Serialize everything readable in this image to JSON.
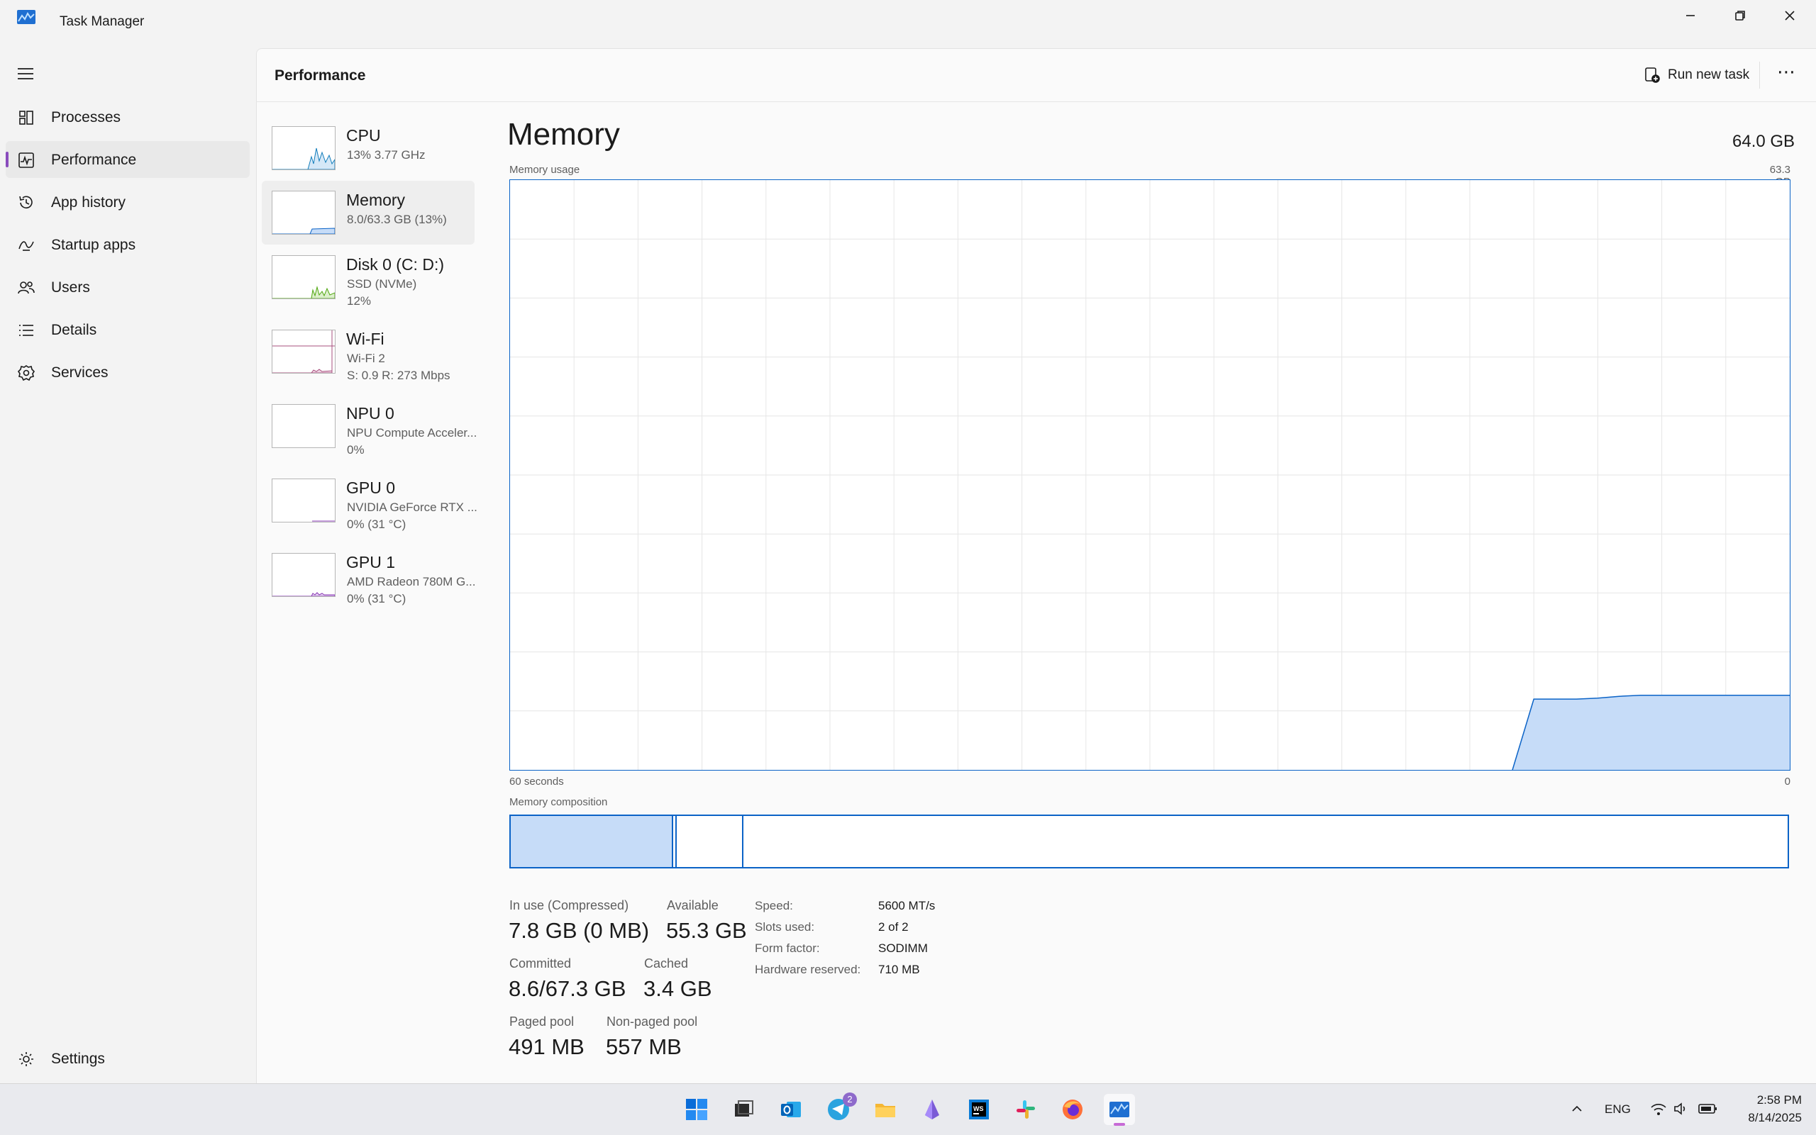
{
  "window": {
    "title": "Task Manager",
    "app_icon": "task-manager-icon"
  },
  "nav": {
    "items": [
      {
        "label": "Processes",
        "icon": "processes-icon"
      },
      {
        "label": "Performance",
        "icon": "performance-icon",
        "active": true
      },
      {
        "label": "App history",
        "icon": "app-history-icon"
      },
      {
        "label": "Startup apps",
        "icon": "startup-apps-icon"
      },
      {
        "label": "Users",
        "icon": "users-icon"
      },
      {
        "label": "Details",
        "icon": "details-icon"
      },
      {
        "label": "Services",
        "icon": "services-icon"
      }
    ],
    "settings": {
      "label": "Settings",
      "icon": "settings-icon"
    }
  },
  "header": {
    "title": "Performance",
    "run_new_task": "Run new task",
    "more": "⋯"
  },
  "resources": [
    {
      "name": "CPU",
      "sub1": "13% 3.77 GHz",
      "color": "#117dbb"
    },
    {
      "name": "Memory",
      "sub1": "8.0/63.3 GB (13%)",
      "color": "#0b63c7",
      "selected": true
    },
    {
      "name": "Disk 0 (C: D:)",
      "sub1": "SSD (NVMe)",
      "sub2": "12%",
      "color": "#4da60c"
    },
    {
      "name": "Wi-Fi",
      "sub1": "Wi-Fi 2",
      "sub2": "S: 0.9  R: 273 Mbps",
      "color": "#a74f7e"
    },
    {
      "name": "NPU 0",
      "sub1": "NPU Compute Acceler...",
      "sub2": "0%",
      "color": "#117dbb"
    },
    {
      "name": "GPU 0",
      "sub1": "NVIDIA GeForce RTX ...",
      "sub2": "0%  (31 °C)",
      "color": "#8a3ab5"
    },
    {
      "name": "GPU 1",
      "sub1": "AMD Radeon 780M G...",
      "sub2": "0%  (31 °C)",
      "color": "#8a3ab5"
    }
  ],
  "memory": {
    "title": "Memory",
    "total": "64.0 GB",
    "usage_label": "Memory usage",
    "usage_max": "63.3 GB",
    "time_left": "60 seconds",
    "time_right": "0",
    "composition_label": "Memory composition",
    "composition": {
      "in_use_fraction": 0.126,
      "modified_fraction": 0.002,
      "standby_fraction": 0.051
    },
    "usage_series_gb": [
      0,
      0,
      0,
      0,
      0,
      0,
      0,
      0,
      0,
      0,
      0,
      0,
      0,
      0,
      0,
      0,
      0,
      0,
      0,
      0,
      0,
      0,
      0,
      0,
      0,
      0,
      0,
      0,
      0,
      0,
      0,
      0,
      0,
      0,
      0,
      0,
      0,
      0,
      0,
      0,
      0,
      0,
      0,
      0,
      0,
      0,
      0,
      0,
      7.6,
      7.6,
      7.6,
      7.7,
      7.9,
      8.0,
      8.0,
      8.0,
      8.0,
      8.0,
      8.0,
      8.0,
      8.0
    ]
  },
  "stats": {
    "in_use_label": "In use (Compressed)",
    "in_use_value": "7.8 GB (0 MB)",
    "available_label": "Available",
    "available_value": "55.3 GB",
    "committed_label": "Committed",
    "committed_value": "8.6/67.3 GB",
    "cached_label": "Cached",
    "cached_value": "3.4 GB",
    "paged_label": "Paged pool",
    "paged_value": "491 MB",
    "nonpaged_label": "Non-paged pool",
    "nonpaged_value": "557 MB"
  },
  "specs": {
    "speed_label": "Speed:",
    "speed_value": "5600 MT/s",
    "slots_label": "Slots used:",
    "slots_value": "2 of 2",
    "form_label": "Form factor:",
    "form_value": "SODIMM",
    "hw_label": "Hardware reserved:",
    "hw_value": "710 MB"
  },
  "taskbar": {
    "apps": [
      "start-icon",
      "task-view-icon",
      "outlook-icon",
      "telegram-icon",
      "file-explorer-icon",
      "app-icon",
      "webstorm-icon",
      "slack-icon",
      "firefox-icon",
      "task-manager-icon"
    ],
    "telegram_badge": "2",
    "language": "ENG",
    "time": "2:58 PM",
    "date": "8/14/2025"
  },
  "colors": {
    "accent": "#0b63c7",
    "fill": "#c6dcf8",
    "nav_indicator": "#8a4cbd"
  }
}
